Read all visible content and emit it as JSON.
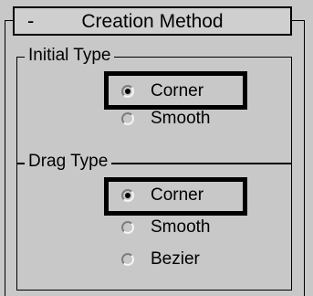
{
  "rollout": {
    "toggle": "-",
    "title": "Creation Method"
  },
  "initial_type": {
    "legend": "Initial Type",
    "options": [
      {
        "label": "Corner",
        "checked": true
      },
      {
        "label": "Smooth",
        "checked": false
      }
    ]
  },
  "drag_type": {
    "legend": "Drag Type",
    "options": [
      {
        "label": "Corner",
        "checked": true
      },
      {
        "label": "Smooth",
        "checked": false
      },
      {
        "label": "Bezier",
        "checked": false
      }
    ]
  },
  "colors": {
    "panel_background": "#c8c8c8",
    "border": "#000000"
  }
}
